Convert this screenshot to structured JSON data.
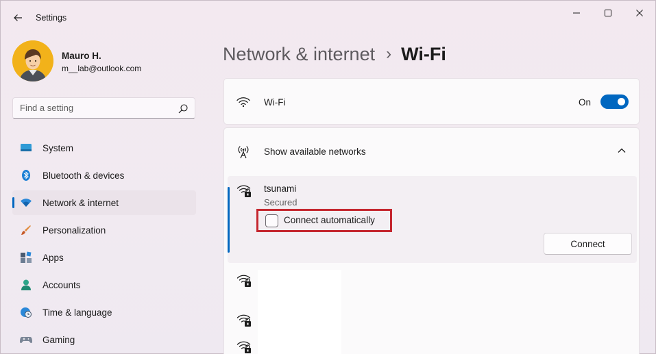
{
  "window": {
    "title": "Settings",
    "controls": {
      "minimize": "minimize",
      "maximize": "maximize",
      "close": "close"
    }
  },
  "profile": {
    "name": "Mauro H.",
    "email": "m__lab@outlook.com"
  },
  "search": {
    "placeholder": "Find a setting"
  },
  "sidebar": {
    "items": [
      {
        "label": "System",
        "icon": "system-icon",
        "selected": false
      },
      {
        "label": "Bluetooth & devices",
        "icon": "bluetooth-icon",
        "selected": false
      },
      {
        "label": "Network & internet",
        "icon": "network-icon",
        "selected": true
      },
      {
        "label": "Personalization",
        "icon": "brush-icon",
        "selected": false
      },
      {
        "label": "Apps",
        "icon": "apps-icon",
        "selected": false
      },
      {
        "label": "Accounts",
        "icon": "accounts-icon",
        "selected": false
      },
      {
        "label": "Time & language",
        "icon": "globe-clock-icon",
        "selected": false
      },
      {
        "label": "Gaming",
        "icon": "gamepad-icon",
        "selected": false
      }
    ]
  },
  "header": {
    "parent": "Network & internet",
    "separator": "›",
    "current": "Wi-Fi"
  },
  "wifi": {
    "label": "Wi-Fi",
    "state_label": "On",
    "enabled": true
  },
  "networks": {
    "section_label": "Show available networks",
    "expanded": true,
    "selected_network": {
      "name": "tsunami",
      "status": "Secured",
      "auto_connect_label": "Connect automatically",
      "auto_connect_checked": false,
      "connect_label": "Connect"
    },
    "other_networks_count": 3
  },
  "colors": {
    "accent": "#0067c0",
    "highlight_box": "#c4262e",
    "background": "#f3e9f0"
  }
}
